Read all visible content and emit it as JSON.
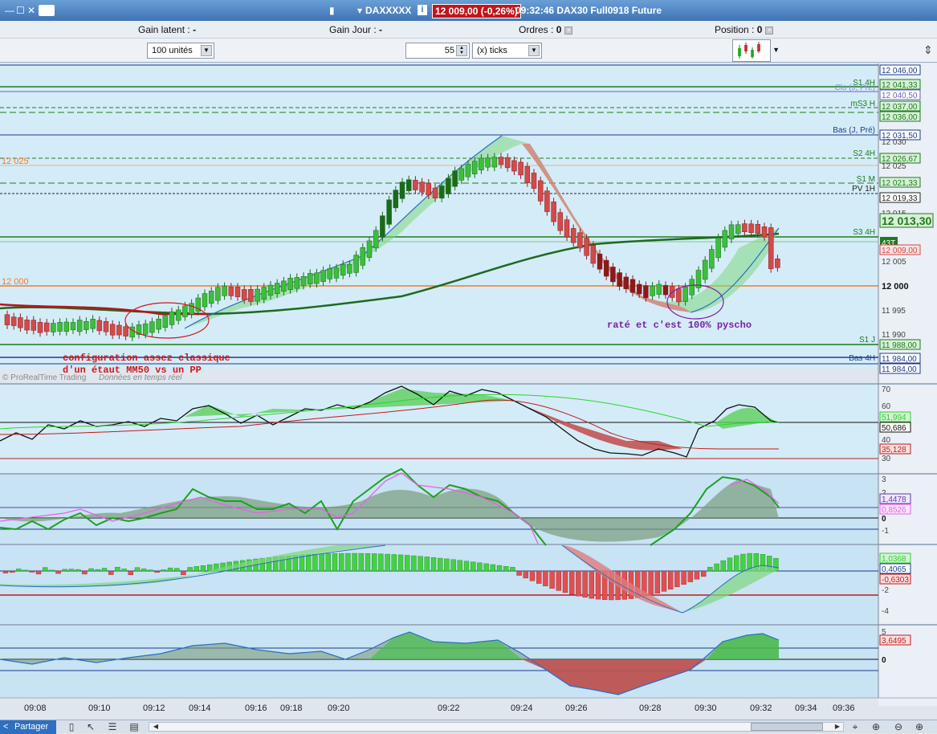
{
  "window": {
    "symbol": "DAXXXXX",
    "price_badge": "12 009,00 (-0,26%)",
    "time_title": "09:32:46  DAX30 Full0918 Future",
    "minimize": "—",
    "restore": "☐",
    "close": "✕",
    "symbol_icon": "▾"
  },
  "status": {
    "gain_latent_label": "Gain latent :",
    "gain_latent_value": "-",
    "gain_jour_label": "Gain Jour :",
    "gain_jour_value": "-",
    "ordres_label": "Ordres :",
    "ordres_value": "0",
    "position_label": "Position :",
    "position_value": "0"
  },
  "toolbar": {
    "units_value": "100 unités",
    "ticks_count": "55",
    "ticks_unit": "(x) ticks"
  },
  "price_axis": {
    "labels": [
      "12 046,00",
      "12 041,33",
      "12 040,50",
      "12 037,00",
      "12 036,00",
      "12 031,50",
      "12 026,67",
      "12 021,33",
      "12 019,33",
      "12 013,30",
      "12 009,00",
      "11 988,00",
      "11 984,00",
      "11 984,00"
    ],
    "ticks": [
      "12 030",
      "12 025",
      "12 015",
      "12 005",
      "12 000",
      "11 995",
      "11 990"
    ],
    "tick_12000": "12 000",
    "current": "12 013,30",
    "current_box": "43T"
  },
  "level_labels": {
    "s1_4h": "S1 4H",
    "clo": "Clo (J, Pré)",
    "ms3": "mS3 H",
    "bas": "Bas (J, Pré)",
    "s2_4h": "S2 4H",
    "s1_m": "S1 M",
    "pv": "PV 1H",
    "s3_4h": "S3 4H",
    "s1_j": "S1 J",
    "bas4h": "Bas 4H",
    "left_12025": "12 025",
    "left_12000": "12 000"
  },
  "annotations": {
    "config_line1": "configuration assez classique",
    "config_line2": "d'un étaut MM50 vs un PP",
    "rate": "raté et c'est 100% pyscho",
    "watermark": "© ProRealTime Trading",
    "watermark_italic": "Données en temps réel"
  },
  "panel1_axis": {
    "ticks": [
      "70",
      "60",
      "50",
      "40",
      "30"
    ],
    "val_green": "51,994",
    "val_black": "50,686",
    "val_red": "35,128"
  },
  "panel2_axis": {
    "ticks": [
      "3",
      "2",
      "1",
      "0",
      "-1"
    ],
    "val_purple": "1,4478",
    "val_pink": "0,8526"
  },
  "panel3_axis": {
    "ticks": [
      "-2",
      "-4"
    ],
    "val_green": "1,0368",
    "val_blue": "0,4065",
    "val_red": "-0,6303"
  },
  "panel4_axis": {
    "ticks": [
      "5",
      "0"
    ],
    "val_red": "3,6495"
  },
  "time_axis": [
    "09:08",
    "09:10",
    "09:12",
    "09:14",
    "09:16",
    "09:18",
    "09:20",
    "09:22",
    "09:24",
    "09:26",
    "09:28",
    "09:30",
    "09:32",
    "09:34",
    "09:36"
  ],
  "bottom": {
    "share": "Partager"
  },
  "colors": {
    "bull": "#3cbf3c",
    "bear": "#d24a4a",
    "ma50": "#1f7a1f",
    "pp": "#f07b2a",
    "annotation_red": "#d4171c",
    "annotation_purple": "#7a1fa8",
    "panel_bg": "#c7e3f4"
  }
}
